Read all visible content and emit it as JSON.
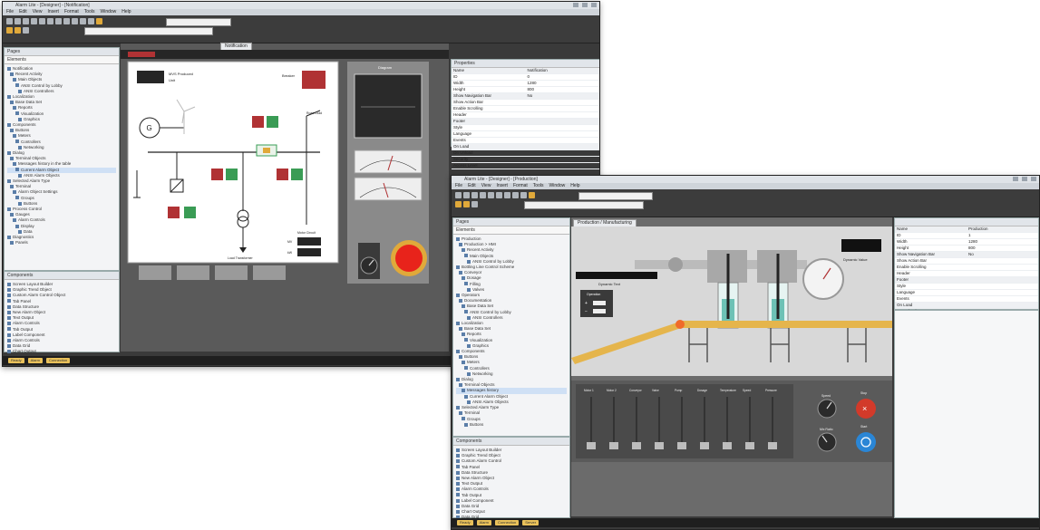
{
  "window1": {
    "title": "Alarm Lite - [Designer] - [Notification]",
    "menu": [
      "File",
      "Edit",
      "View",
      "Insert",
      "Format",
      "Tools",
      "Window",
      "Help"
    ],
    "tab_label": "Notification",
    "tree_header": "Pages",
    "tree_title": "Elements",
    "tree_items": [
      "Notification",
      "Recent Activity",
      "Main Objects",
      "ANSI Control by Lobby",
      "ANSI Controllers",
      "Localization",
      "Base Data Set",
      "Reports",
      "Visualization",
      "Graphics",
      "Components",
      "Buttons",
      "Meters",
      "Controllers",
      "Networking",
      "Dialog",
      "Terminal Objects",
      "Messages history in the table",
      "Current Alarm Object",
      "ANSI Alarm Objects",
      "Selected Alarm Type",
      "Terminal",
      "Alarm Object Settings",
      "Groups",
      "Buttons",
      "Process Control",
      "Gauges",
      "Alarm Controls",
      "Display",
      "Data",
      "Diagnostics",
      "Panels"
    ],
    "components_header": "Components",
    "components": [
      "Screen Layout Builder",
      "Graphic Trend Object",
      "Custom Alarm Control Object",
      "Tab Panel",
      "Data Structure",
      "New Alarm Object",
      "Text Output",
      "Alarm Controls",
      "Tab Output",
      "Label Component",
      "Alarm Controls",
      "Data Grid",
      "Chart Output"
    ],
    "panel": {
      "label_generator": "MVS Produced",
      "label_units": "Unit",
      "label_breaker": "Breaker",
      "label_load": "Road Load",
      "label_transformer": "Load Transformer",
      "label_motor": "Motor Circuit",
      "label_mv": "MV",
      "label_kw": "kW",
      "gen_symbol": "G",
      "gauge_title": "Diagram",
      "meter1": "",
      "meter2": ""
    },
    "right_bar_label": "Diagnostics",
    "props_title": "Properties",
    "props": [
      [
        "Name",
        "Notification"
      ],
      [
        "ID",
        "0"
      ],
      [
        "Width",
        "1280"
      ],
      [
        "Height",
        "800"
      ],
      [
        "Show Navigation Bar",
        "No"
      ],
      [
        "Show Action Bar",
        ""
      ],
      [
        "Enable Scrolling",
        ""
      ],
      [
        "Header",
        ""
      ],
      [
        "Footer",
        ""
      ],
      [
        "Style",
        ""
      ],
      [
        "Language",
        ""
      ],
      [
        "Events",
        ""
      ],
      [
        "On Load",
        ""
      ],
      [
        "On Unload",
        ""
      ],
      [
        "Security",
        ""
      ],
      [
        "Access Level",
        ""
      ]
    ],
    "status_items": [
      "Ready",
      "Alarm",
      "Connection"
    ]
  },
  "window2": {
    "title": "Alarm Lite - [Designer] - [Production]",
    "menu": [
      "File",
      "Edit",
      "View",
      "Insert",
      "Format",
      "Tools",
      "Window",
      "Help"
    ],
    "tab_label": "Production",
    "page_title": "Production / Manufacturing",
    "tree_header": "Pages",
    "tree_title": "Elements",
    "tree_items": [
      "Production",
      "Production > HMI",
      "Recent Activity",
      "Main Objects",
      "ANSI Control by Lobby",
      "Bottling Line Control Scheme",
      "Conveyor",
      "Dosage",
      "Filling",
      "Valves",
      "Operators",
      "Documentation",
      "Base Data Set",
      "ANSI Control by Lobby",
      "ANSI Controllers",
      "Localization",
      "Base Data Set",
      "Reports",
      "Visualization",
      "Graphics",
      "Components",
      "Buttons",
      "Meters",
      "Controllers",
      "Networking",
      "Dialog",
      "Terminal Objects",
      "Messages history",
      "Current Alarm Object",
      "ANSI Alarm Objects",
      "Selected Alarm Type",
      "Terminal",
      "Groups",
      "Buttons"
    ],
    "components_header": "Components",
    "components": [
      "Screen Layout Builder",
      "Graphic Trend Object",
      "Custom Alarm Control",
      "Tab Panel",
      "Data Structure",
      "New Alarm Object",
      "Text Output",
      "Alarm Controls",
      "Tab Output",
      "Label Component",
      "Data Grid",
      "Chart Output",
      "Data Grid",
      "Alarm Controls"
    ],
    "scene": {
      "counter_label": "Dynamic Text",
      "control_title": "Operation",
      "control_plus": "+",
      "control_minus": "−",
      "gauge_label": "Dynamic Value",
      "slider_labels": [
        "Motor 1",
        "Motor 2",
        "Conveyor",
        "Valve",
        "Pump",
        "Dosage",
        "Temperature",
        "Speed",
        "Pressure"
      ],
      "knob1_label": "Speed",
      "knob2_label": "Mix Ratio",
      "stop_label": "Stop",
      "start_label": "Start"
    },
    "props": [
      [
        "Name",
        "Production"
      ],
      [
        "ID",
        "1"
      ],
      [
        "Width",
        "1280"
      ],
      [
        "Height",
        "800"
      ],
      [
        "Show Navigation Bar",
        "No"
      ],
      [
        "Show Action Bar",
        ""
      ],
      [
        "Enable Scrolling",
        ""
      ],
      [
        "Header",
        ""
      ],
      [
        "Footer",
        ""
      ],
      [
        "Style",
        ""
      ],
      [
        "Language",
        ""
      ],
      [
        "Events",
        ""
      ],
      [
        "On Load",
        ""
      ],
      [
        "On Unload",
        ""
      ],
      [
        "Security",
        ""
      ],
      [
        "Access Level",
        ""
      ]
    ],
    "status_items": [
      "Ready",
      "Alarm",
      "Connection",
      "Server"
    ]
  },
  "colors": {
    "accent": "#e0a93a",
    "green_button": "#3a9c55",
    "red_button": "#b03234",
    "emergency": "#e8231b",
    "canvas_bg": "#5a5a5a"
  }
}
